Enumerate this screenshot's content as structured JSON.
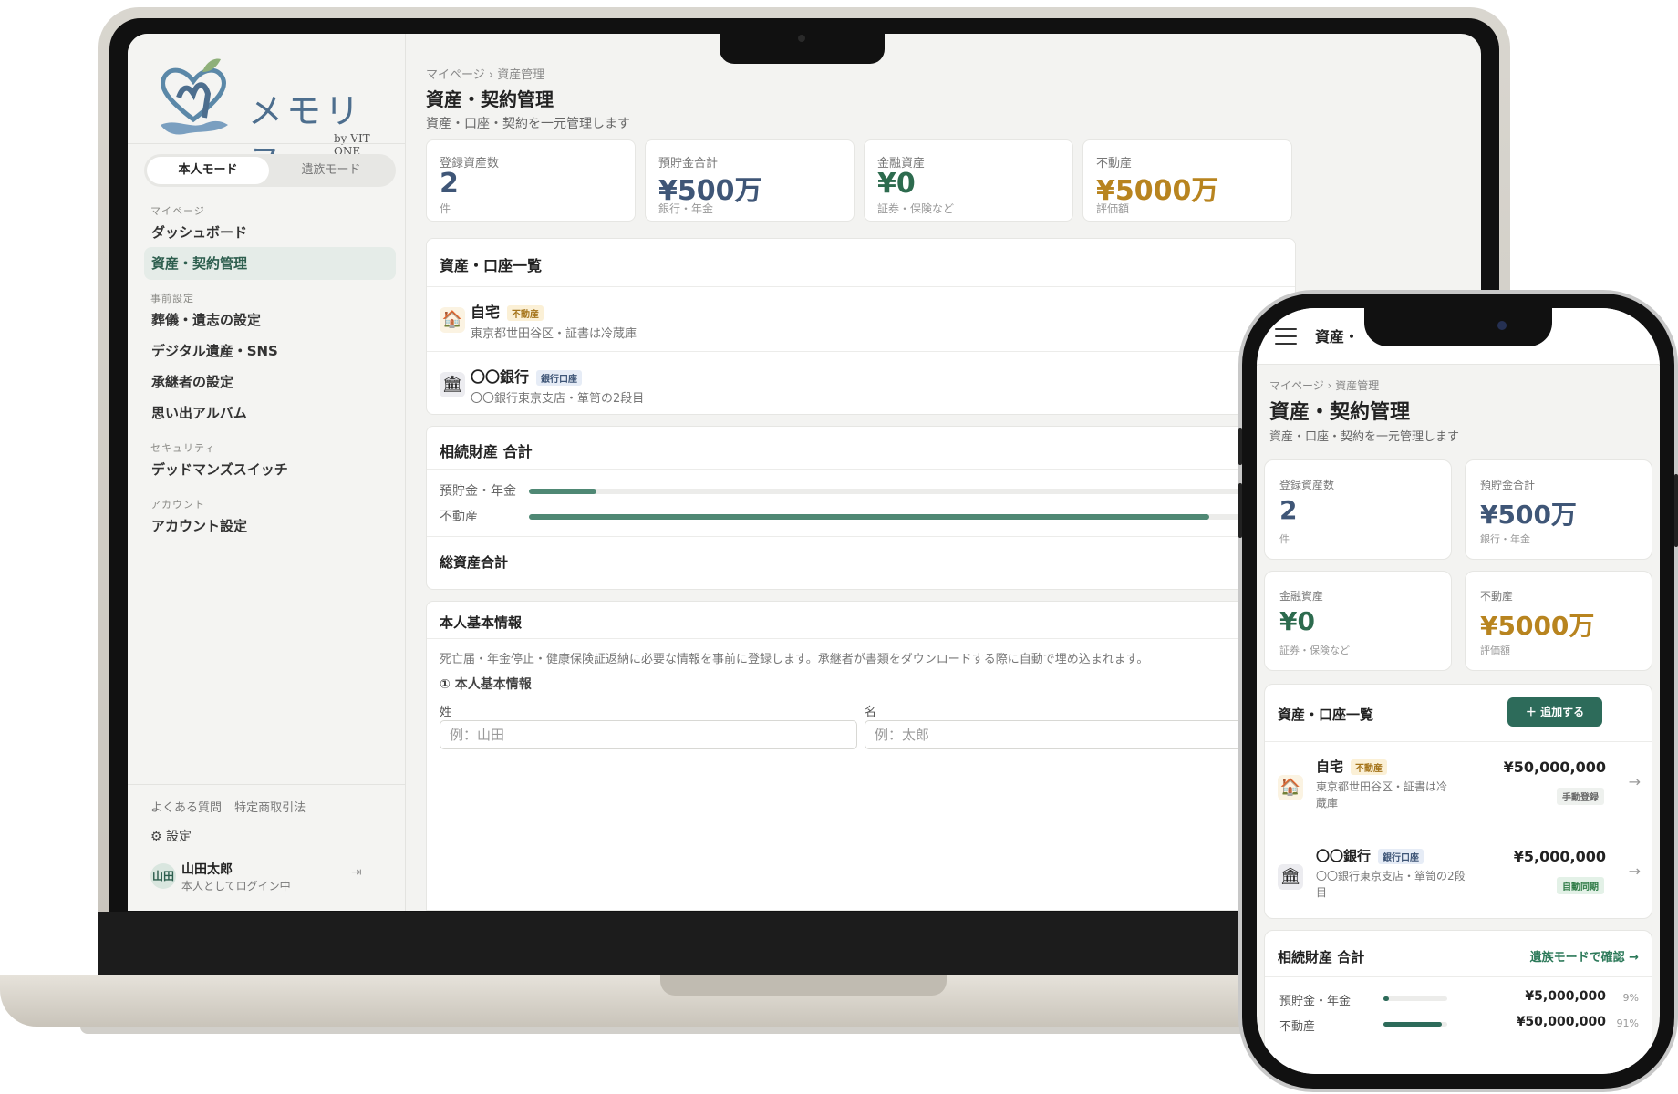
{
  "app": {
    "logo_text": "メモリス",
    "logo_by": "by VIT-ONE"
  },
  "sidebar": {
    "mode_self": "本人モード",
    "mode_family": "遺族モード",
    "sections": {
      "mypage": "マイページ",
      "prep": "事前設定",
      "security": "セキュリティ",
      "account": "アカウント"
    },
    "items": {
      "dashboard": "ダッシュボード",
      "assets": "資産・契約管理",
      "funeral": "葬儀・遺志の設定",
      "digital": "デジタル遺産・SNS",
      "heir": "承継者の設定",
      "album": "思い出アルバム",
      "deadman": "デッドマンズスイッチ",
      "account": "アカウント設定"
    },
    "footer_links": [
      "よくある質問",
      "特定商取引法"
    ],
    "settings_label": "設定",
    "user": {
      "avatar": "山田",
      "name": "山田太郎",
      "status": "本人としてログイン中"
    }
  },
  "page": {
    "breadcrumb": "マイページ › 資産管理",
    "title": "資産・契約管理",
    "subtitle": "資産・口座・契約を一元管理します"
  },
  "stats": [
    {
      "label": "登録資産数",
      "value": "2",
      "note": "件"
    },
    {
      "label": "預貯金合計",
      "value": "¥500万",
      "note": "銀行・年金"
    },
    {
      "label": "金融資産",
      "value": "¥0",
      "note": "証券・保険など"
    },
    {
      "label": "不動産",
      "value": "¥5000万",
      "note": "評価額"
    }
  ],
  "asset_list": {
    "title": "資産・口座一覧",
    "add_button": "追加する",
    "items": [
      {
        "name": "自宅",
        "tag": "不動産",
        "desc": "東京都世田谷区・証書は冷蔵庫",
        "desc_mobile": "東京都世田谷区・証書は冷蔵庫",
        "amount": "¥50,000,000",
        "badge": "手動登録"
      },
      {
        "name": "〇〇銀行",
        "tag": "銀行口座",
        "desc": "〇〇銀行東京支店・箪笥の2段目",
        "desc_mobile": "〇〇銀行東京支店・箪笥の2段目",
        "amount": "¥5,000,000",
        "badge": "自動同期"
      }
    ]
  },
  "inheritance": {
    "title": "相続財産 合計",
    "link": "遺族モードで確認 →",
    "rows": [
      {
        "label": "預貯金・年金",
        "amount": "¥5,000,000",
        "pct": "9%",
        "fraction": 0.09
      },
      {
        "label": "不動産",
        "amount": "¥50,000,000",
        "pct": "91%",
        "fraction": 0.91
      }
    ],
    "total_label": "総資産合計"
  },
  "basic_info": {
    "title": "本人基本情報",
    "desc": "死亡届・年金停止・健康保険証返納に必要な情報を事前に登録します。承継者が書類をダウンロードする際に自動で埋め込まれます。",
    "section": "① 本人基本情報",
    "last_name_label": "姓",
    "last_name_placeholder": "例：山田",
    "first_name_label": "名",
    "first_name_placeholder": "例：太郎"
  },
  "mobile": {
    "header_title": "資産・"
  },
  "colors": {
    "accent": "#2d6b5a",
    "blue": "#3f5677",
    "green": "#2d6b4e",
    "gold": "#b8841f"
  },
  "icons": {
    "house": "house-icon",
    "bank": "bank-icon",
    "gear": "gear-icon",
    "logout": "logout-icon",
    "menu": "menu-icon",
    "plus": "plus-icon"
  }
}
